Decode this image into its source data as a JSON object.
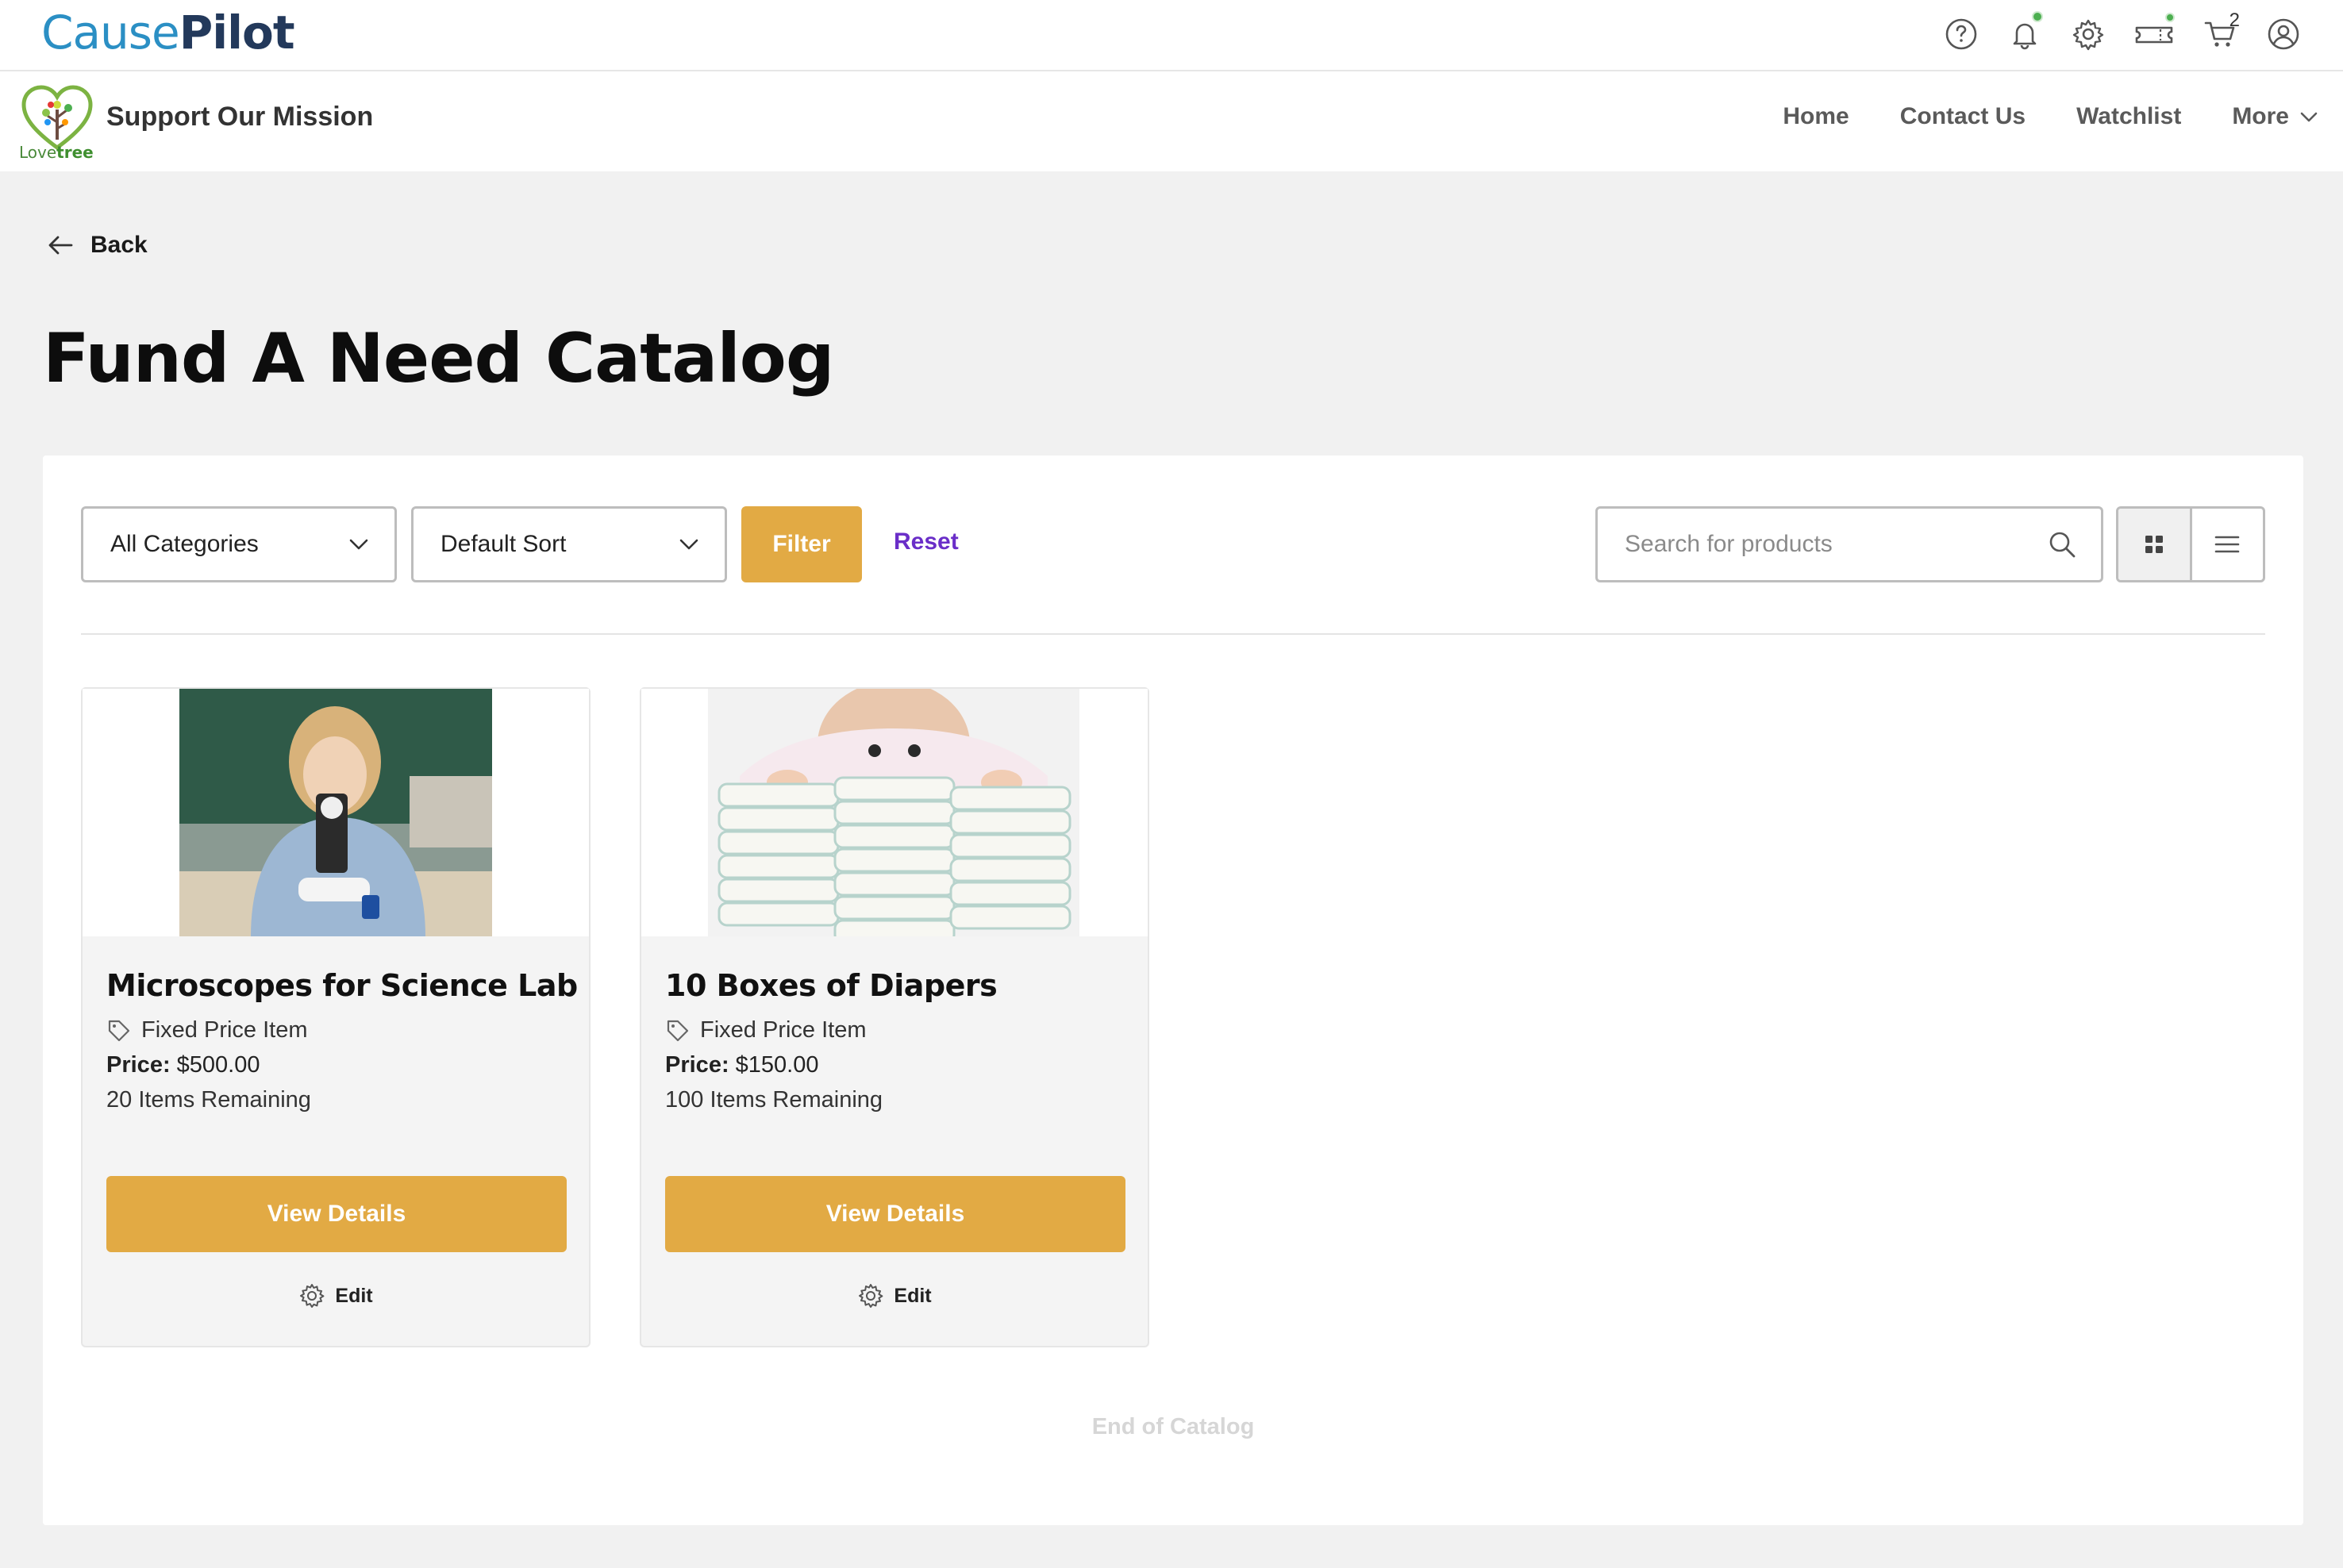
{
  "topbar": {
    "brand_part1": "Cause",
    "brand_part2": "Pilot",
    "icons": [
      "help-icon",
      "bell-icon",
      "gear-icon",
      "ticket-icon",
      "cart-icon",
      "user-icon"
    ],
    "cart_count": "2",
    "status_dot_color": "#4caf50"
  },
  "subnav": {
    "org_logo_part1": "Love",
    "org_logo_part2": "tree",
    "org_name": "Support Our Mission",
    "links": [
      "Home",
      "Contact Us",
      "Watchlist",
      "More"
    ]
  },
  "page": {
    "back_label": "Back",
    "title": "Fund A Need Catalog"
  },
  "toolbar": {
    "category_value": "All Categories",
    "sort_value": "Default Sort",
    "filter_label": "Filter",
    "reset_label": "Reset",
    "search_placeholder": "Search for products",
    "active_view": "grid"
  },
  "products": [
    {
      "title": "Microscopes for Science Lab",
      "type": "Fixed Price Item",
      "price_label": "Price:",
      "price": "$500.00",
      "remaining": "20 Items Remaining",
      "view_label": "View Details",
      "edit_label": "Edit"
    },
    {
      "title": "10 Boxes of Diapers",
      "type": "Fixed Price Item",
      "price_label": "Price:",
      "price": "$150.00",
      "remaining": "100 Items Remaining",
      "view_label": "View Details",
      "edit_label": "Edit"
    }
  ],
  "footer": {
    "end_label": "End of Catalog"
  },
  "colors": {
    "accent": "#e2aa44",
    "reset_link": "#6a2ec8",
    "brand_blue": "#2b8fc4",
    "brand_navy": "#23395b"
  }
}
